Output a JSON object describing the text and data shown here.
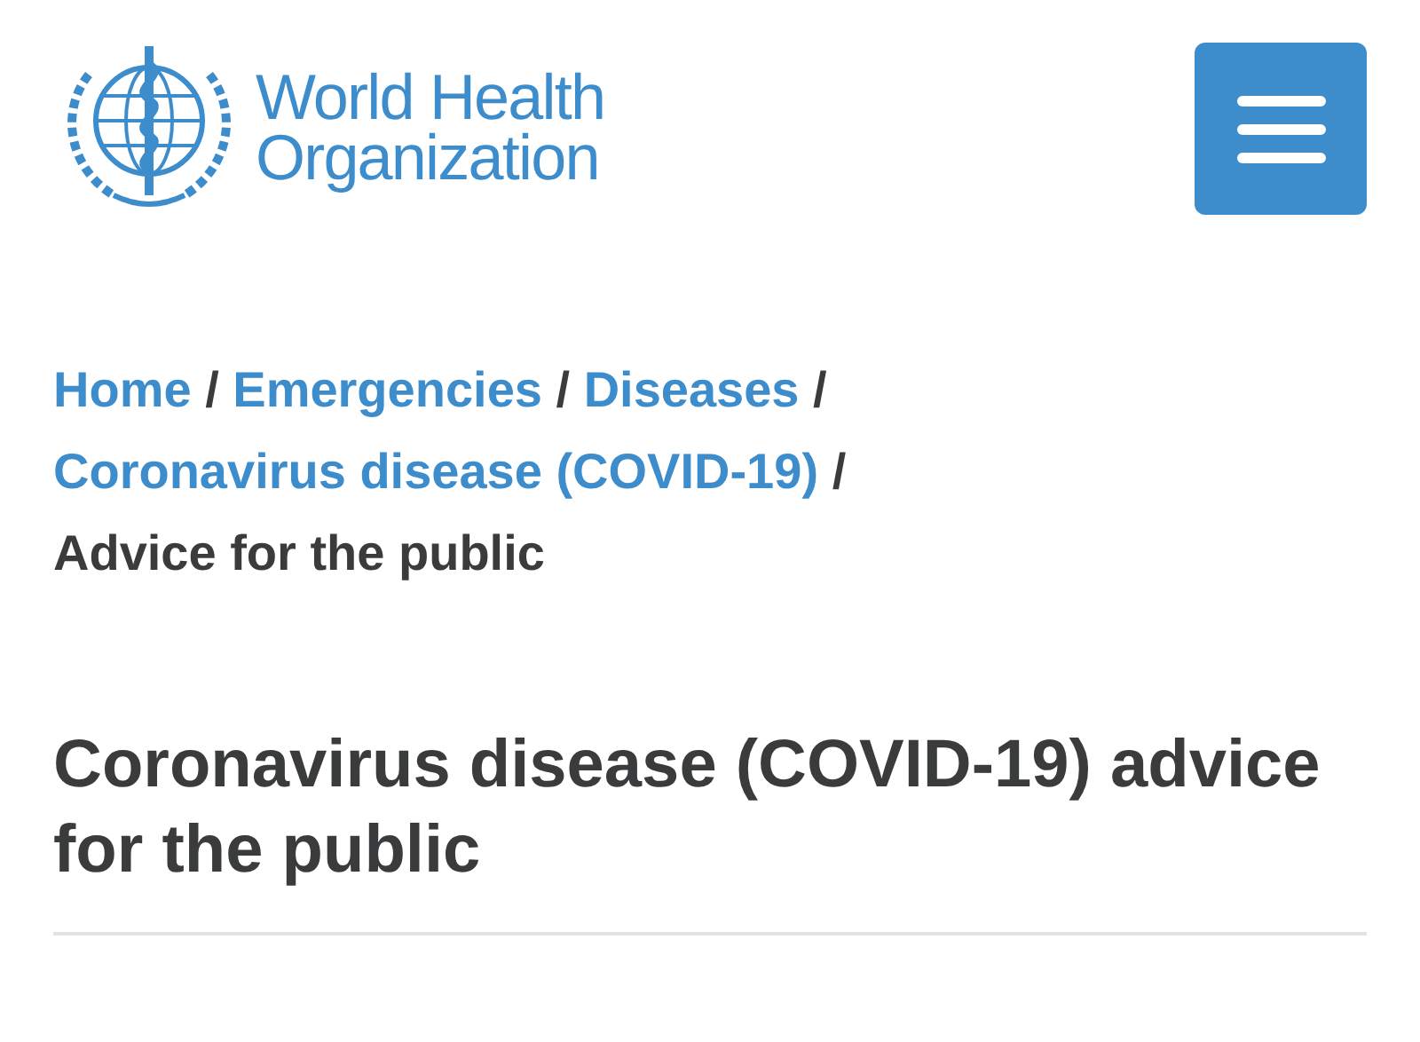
{
  "header": {
    "logo_lines": [
      "World Health",
      "Organization"
    ]
  },
  "breadcrumb": [
    {
      "label": "Home",
      "kind": "link",
      "separator": "/"
    },
    {
      "label": "Emergencies",
      "kind": "link",
      "separator": "/"
    },
    {
      "label": "Diseases",
      "kind": "link",
      "separator": "/"
    },
    {
      "label": "Coronavirus disease (COVID-19)",
      "kind": "link",
      "separator": "/"
    },
    {
      "label": "Advice for the public",
      "kind": "current"
    }
  ],
  "title": "Coronavirus disease (COVID-19) advice for the public"
}
